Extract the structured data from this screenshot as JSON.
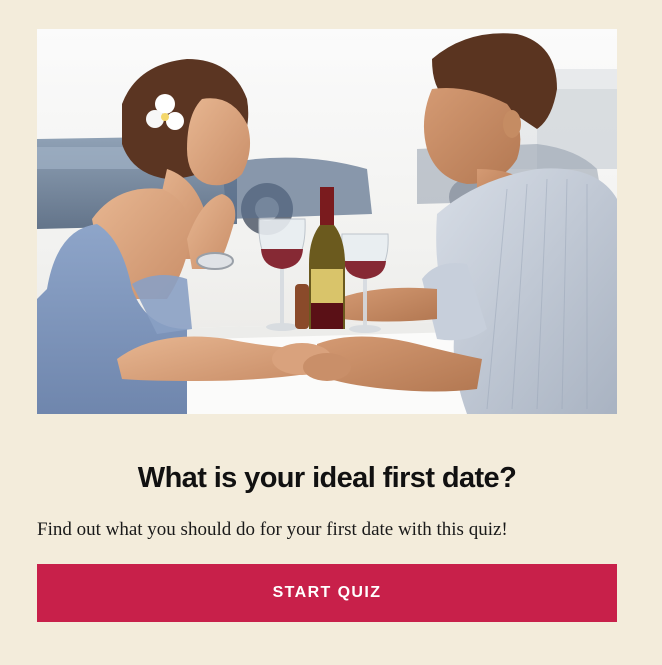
{
  "quiz": {
    "title": "What is your ideal first date?",
    "description": "Find out what you should do for your first date with this quiz!",
    "start_label": "START QUIZ"
  },
  "hero": {
    "alt": "Couple on a date at a restaurant table with red wine"
  },
  "colors": {
    "background": "#f3ecdb",
    "button": "#c8204a",
    "button_text": "#ffffff",
    "title_text": "#111111"
  }
}
